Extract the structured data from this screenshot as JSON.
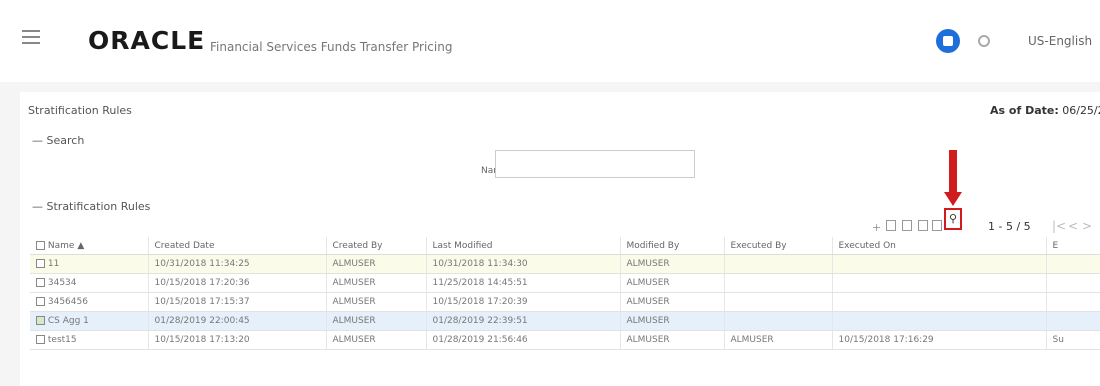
{
  "header": {
    "logo": "ORACLE",
    "app_name": "Financial Services Funds Transfer Pricing",
    "language": "US-English"
  },
  "panel": {
    "title": "Stratification Rules",
    "as_of_label": "As of Date:",
    "as_of_value": "06/25/2"
  },
  "search": {
    "section_label": "Search",
    "name_label": "Name",
    "name_value": ""
  },
  "rules": {
    "section_label": "Stratification Rules",
    "pager": "1 - 5 / 5",
    "columns": [
      "Name",
      "Created Date",
      "Created By",
      "Last Modified",
      "Modified By",
      "Executed By",
      "Executed On",
      "E"
    ],
    "rows": [
      {
        "name": "11",
        "created_date": "10/31/2018 11:34:25",
        "created_by": "ALMUSER",
        "last_modified": "10/31/2018 11:34:30",
        "modified_by": "ALMUSER",
        "executed_by": "",
        "executed_on": "",
        "e": ""
      },
      {
        "name": "34534",
        "created_date": "10/15/2018 17:20:36",
        "created_by": "ALMUSER",
        "last_modified": "11/25/2018 14:45:51",
        "modified_by": "ALMUSER",
        "executed_by": "",
        "executed_on": "",
        "e": ""
      },
      {
        "name": "3456456",
        "created_date": "10/15/2018 17:15:37",
        "created_by": "ALMUSER",
        "last_modified": "10/15/2018 17:20:39",
        "modified_by": "ALMUSER",
        "executed_by": "",
        "executed_on": "",
        "e": ""
      },
      {
        "name": "CS Agg 1",
        "created_date": "01/28/2019 22:00:45",
        "created_by": "ALMUSER",
        "last_modified": "01/28/2019 22:39:51",
        "modified_by": "ALMUSER",
        "executed_by": "",
        "executed_on": "",
        "e": ""
      },
      {
        "name": "test15",
        "created_date": "10/15/2018 17:13:20",
        "created_by": "ALMUSER",
        "last_modified": "01/28/2019 21:56:46",
        "modified_by": "ALMUSER",
        "executed_by": "ALMUSER",
        "executed_on": "10/15/2018 17:16:29",
        "e": "Su"
      }
    ]
  },
  "colors": {
    "accent": "#1e6fd9",
    "highlight": "#d01c1c"
  }
}
